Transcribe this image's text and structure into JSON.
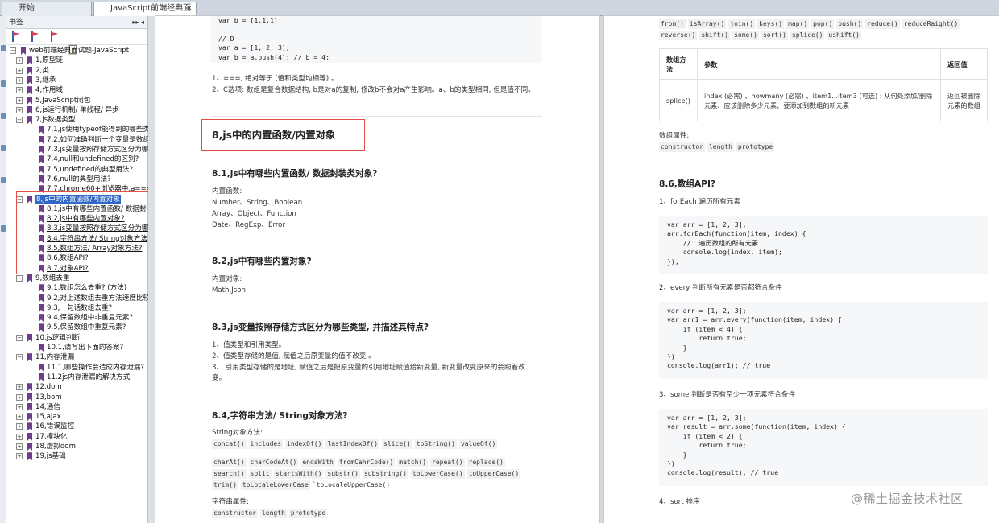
{
  "tabs": [
    {
      "label": "开始"
    },
    {
      "label": "JavaScript前端经典面试...",
      "close": "×"
    }
  ],
  "bookmarks": {
    "header": "书签",
    "header_controls": "▸▸ ◂",
    "items": [
      {
        "label": "web前端经典面试题-JavaScript"
      },
      {
        "label": "1,原型链"
      },
      {
        "label": "2,类"
      },
      {
        "label": "3,继承"
      },
      {
        "label": "4,作用域"
      },
      {
        "label": "5,JavaScript闭包"
      },
      {
        "label": "6,js运行机制/ 单线程/ 异步"
      },
      {
        "label": "7,js数据类型"
      },
      {
        "label": "7.1,js使用typeof能得到的哪些类"
      },
      {
        "label": "7.2,如何准确判断一个变量是数组"
      },
      {
        "label": "7.3,js变量按照存储方式区分为哪"
      },
      {
        "label": "7.4,null和undefined的区别?"
      },
      {
        "label": "7.5,undefined的典型用法?"
      },
      {
        "label": "7.6,null的典型用法?"
      },
      {
        "label": "7.7,chrome60+浏览器中,a==="
      },
      {
        "label": "8,js中的内置函数/内置对象"
      },
      {
        "label": "8.1,js中有哪些内置函数/ 数据封"
      },
      {
        "label": "8.2,js中有哪些内置对象?"
      },
      {
        "label": "8.3,js变量按照存储方式区分为哪"
      },
      {
        "label": "8.4,字符串方法/ String对象方法"
      },
      {
        "label": "8.5,数组方法/ Array对象方法?"
      },
      {
        "label": "8.6,数组API?"
      },
      {
        "label": "8.7,对象API?"
      },
      {
        "label": "9,数组去重"
      },
      {
        "label": "9.1,数组怎么去重? (方法)"
      },
      {
        "label": "9.2,对上述数组去重方法速度比较"
      },
      {
        "label": "9.3,一句话数组去重?"
      },
      {
        "label": "9.4,保留数组中非重复元素?"
      },
      {
        "label": "9.5,保留数组中重复元素?"
      },
      {
        "label": "10,js逻辑判断"
      },
      {
        "label": "10.1,请写出下面的答案?"
      },
      {
        "label": "11,内存泄漏"
      },
      {
        "label": "11.1,哪些操作会造成内存泄漏?"
      },
      {
        "label": "11.2js内存泄漏的解决方式"
      },
      {
        "label": "12,dom"
      },
      {
        "label": "13,bom"
      },
      {
        "label": "14,通信"
      },
      {
        "label": "15,ajax"
      },
      {
        "label": "16,错误监控"
      },
      {
        "label": "17,模块化"
      },
      {
        "label": "18,虚拟dom"
      },
      {
        "label": "19,js基础"
      }
    ]
  },
  "page1": {
    "code_top": "var b = [1,1,1];\n\n// D\nvar a = [1, 2, 3];\nvar b = a.push(4); // b = 4;",
    "note1": "1、===, 绝对等于 (值和类型均相等) 。",
    "note2": "2、C选项: 数组是复合数据结构, b是对a的复制, 修改b不会对a产生影响。a、b的类型相同, 但是值不同。",
    "h2": "8,js中的内置函数/内置对象",
    "s1_title": "8.1,js中有哪些内置函数/ 数据封装类对象?",
    "s1_label": "内置函数:",
    "s1_line1": "Number、String、Boolean",
    "s1_line2": "Array、Object、Function",
    "s1_line3": "Date、RegExp、Error",
    "s2_title": "8.2,js中有哪些内置对象?",
    "s2_label": "内置对象:",
    "s2_line1": "Math,Json",
    "s3_title": "8.3,js变量按照存储方式区分为哪些类型, 并描述其特点?",
    "s3_line1": "1、值类型和引用类型。",
    "s3_line2": "2、值类型存储的是值, 赋值之后原变量的值不改变 。",
    "s3_line3": "3、 引用类型存储的是地址, 赋值之后是把原变量的引用地址赋值给新变量, 新变量改变原来的会跟着改变。",
    "s4_title": "8.4,字符串方法/ String对象方法?",
    "s4_label": "String对象方法:",
    "s4_chips1": [
      "concat()",
      "includes",
      "indexOf()",
      "lastIndexOf()",
      "slice()",
      "toString()",
      "valueOf()"
    ],
    "s4_chips2": [
      "charAt()",
      "charCodeAt()",
      "endsWith",
      "fromCahrCode()",
      "match()",
      "repeat()",
      "replace()"
    ],
    "s4_chips3": [
      "search()",
      "split",
      "startsWith()",
      "substr()",
      "substring()",
      "toLowerCase()",
      "toUpperCase()"
    ],
    "s4_chips4a": [
      "trim()",
      "toLocaleLowerCase"
    ],
    "s4_chips4b": "`toLocaleUpperCase()",
    "s4_prop_label": "字符串属性:",
    "s4_props": [
      "constructor",
      "length",
      "prototype"
    ]
  },
  "page2": {
    "chips_top1": [
      "from()",
      "isArray()",
      "join()",
      "keys()",
      "map()",
      "pop()",
      "push()",
      "reduce()",
      "reduceRaight()"
    ],
    "chips_top2": [
      "reverse()",
      "shift()",
      "some()",
      "sort()",
      "splice()",
      "ushift()"
    ],
    "table": {
      "headers": [
        "数组方法",
        "参数",
        "返回值"
      ],
      "row": [
        "splice()",
        "index (必需) 、howmany (必需) 、item1...item3 (可选) : 从何处添加/删除元素、应该删除多少元素、要添加到数组的新元素",
        "返回被删除元素的数组"
      ]
    },
    "prop_label": "数组属性:",
    "props": [
      "constructor",
      "length",
      "prototype"
    ],
    "h3": "8.6,数组API?",
    "i1": "1、forEach 遍历所有元素",
    "code1": "var arr = [1, 2, 3];\narr.forEach(function(item, index) {\n    //  遍历数组的所有元素\n    console.log(index, item);\n});",
    "i2": "2、every 判断所有元素是否都符合条件",
    "code2": "var arr = [1, 2, 3];\nvar arr1 = arr.every(function(item, index) {\n    if (item < 4) {\n        return true;\n    }\n})\nconsole.log(arr1); // true",
    "i3": "3、some 判断是否有至少一项元素符合条件",
    "code3": "var arr = [1, 2, 3];\nvar result = arr.some(function(item, index) {\n    if (item < 2) {\n        return true;\n    }\n})\nconsole.log(result); // true",
    "i4": "4、sort 排序",
    "watermark": "@稀土掘金技术社区"
  }
}
